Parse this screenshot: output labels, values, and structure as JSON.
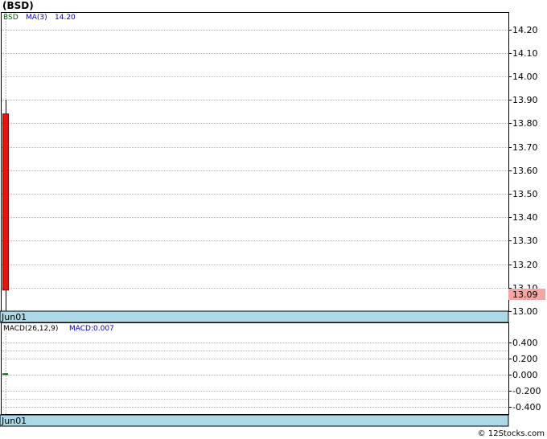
{
  "symbol_label": "(BSD)",
  "credit": "© 12Stocks.com",
  "colors": {
    "background": "#ffffff",
    "grid": "#b4b4b4",
    "date_bar": "#add8e6",
    "candle_down": "#e8140c",
    "price_tag": "#f4a6a6",
    "legend_symbol": "#006400",
    "legend_ma": "#0000cd",
    "macd_line": "#006400"
  },
  "price_panel": {
    "legend": {
      "symbol": "BSD",
      "ma_label": "MA(3)",
      "ma_value": "14.20"
    },
    "last_price_label": "13.09",
    "date_label": "Jun01"
  },
  "macd_panel": {
    "legend": {
      "params": "MACD(26,12,9)",
      "value_label": "MACD:0.007"
    },
    "date_label": "Jun01"
  },
  "chart_data": [
    {
      "type": "candlestick",
      "title": "(BSD)",
      "ylim": [
        13.0,
        14.25
      ],
      "y_ticks": [
        "14.20",
        "14.10",
        "14.00",
        "13.90",
        "13.80",
        "13.70",
        "13.60",
        "13.50",
        "13.40",
        "13.30",
        "13.20",
        "13.10",
        "13.00"
      ],
      "x_tick_labels": [
        "Jun01"
      ],
      "grid": true,
      "candles": [
        {
          "date": "Jun01",
          "open": 13.84,
          "high": 13.9,
          "low": 13.0,
          "close": 13.09
        }
      ],
      "moving_average": {
        "name": "MA(3)",
        "last_value": 14.2
      },
      "last_price": 13.09
    },
    {
      "type": "line",
      "title": "MACD(26,12,9)",
      "ylim": [
        -0.5,
        0.5
      ],
      "y_ticks": [
        "0.400",
        "0.200",
        "0.000",
        "-0.200",
        "-0.400"
      ],
      "x_tick_labels": [
        "Jun01"
      ],
      "grid": true,
      "series": [
        {
          "name": "MACD",
          "values": [
            0.007
          ]
        }
      ]
    }
  ]
}
